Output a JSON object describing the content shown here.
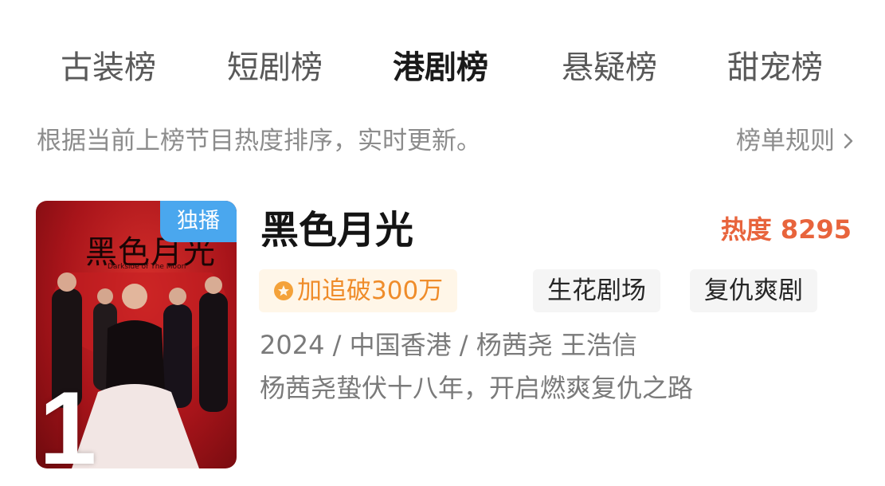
{
  "tabs": [
    {
      "label": "古装榜",
      "active": false
    },
    {
      "label": "短剧榜",
      "active": false
    },
    {
      "label": "港剧榜",
      "active": true
    },
    {
      "label": "悬疑榜",
      "active": false
    },
    {
      "label": "甜宠榜",
      "active": false
    }
  ],
  "subheader": {
    "description": "根据当前上榜节目热度排序，实时更新。",
    "rules_link": "榜单规则"
  },
  "items": [
    {
      "rank": "1",
      "badge": "独播",
      "poster_title": "黑色月光",
      "poster_subtitle": "Darkside of The Moon",
      "title": "黑色月光",
      "heat": "热度 8295",
      "tags": [
        {
          "label": "加追破300万",
          "icon": "star-badge-icon",
          "highlight": true
        },
        {
          "label": "生花剧场",
          "highlight": false
        },
        {
          "label": "复仇爽剧",
          "highlight": false
        }
      ],
      "meta": "2024 / 中国香港 / 杨茜尧 王浩信",
      "synopsis": "杨茜尧蛰伏十八年，开启燃爽复仇之路"
    }
  ],
  "colors": {
    "accent_heat": "#e8643c",
    "badge_blue": "#4aa7ee",
    "tag_highlight_text": "#ef8c2a",
    "tag_highlight_bg": "#fff6e8"
  }
}
